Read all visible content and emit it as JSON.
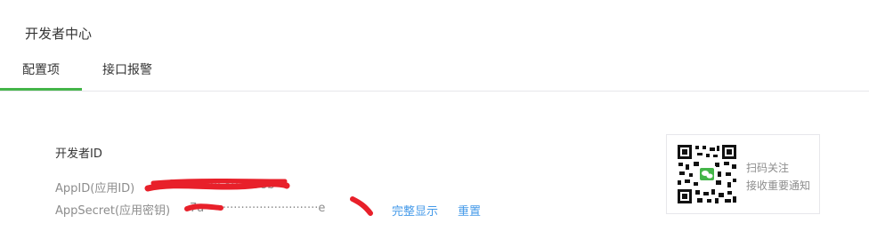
{
  "header": {
    "title": "开发者中心"
  },
  "tabs": [
    {
      "label": "配置项",
      "active": true
    },
    {
      "label": "接口报警",
      "active": false
    }
  ],
  "developer": {
    "section_title": "开发者ID",
    "appid_label": "AppID(应用ID)",
    "appid_value": "wx730···bbc39aa98b",
    "secret_label": "AppSecret(应用密钥)",
    "secret_value": "7a·······························e",
    "show_link": "完整显示",
    "reset_link": "重置"
  },
  "qr_card": {
    "line1": "扫码关注",
    "line2": "接收重要通知"
  },
  "colors": {
    "accent": "#44b549",
    "link": "#459ae9",
    "redaction": "#e8202a"
  }
}
